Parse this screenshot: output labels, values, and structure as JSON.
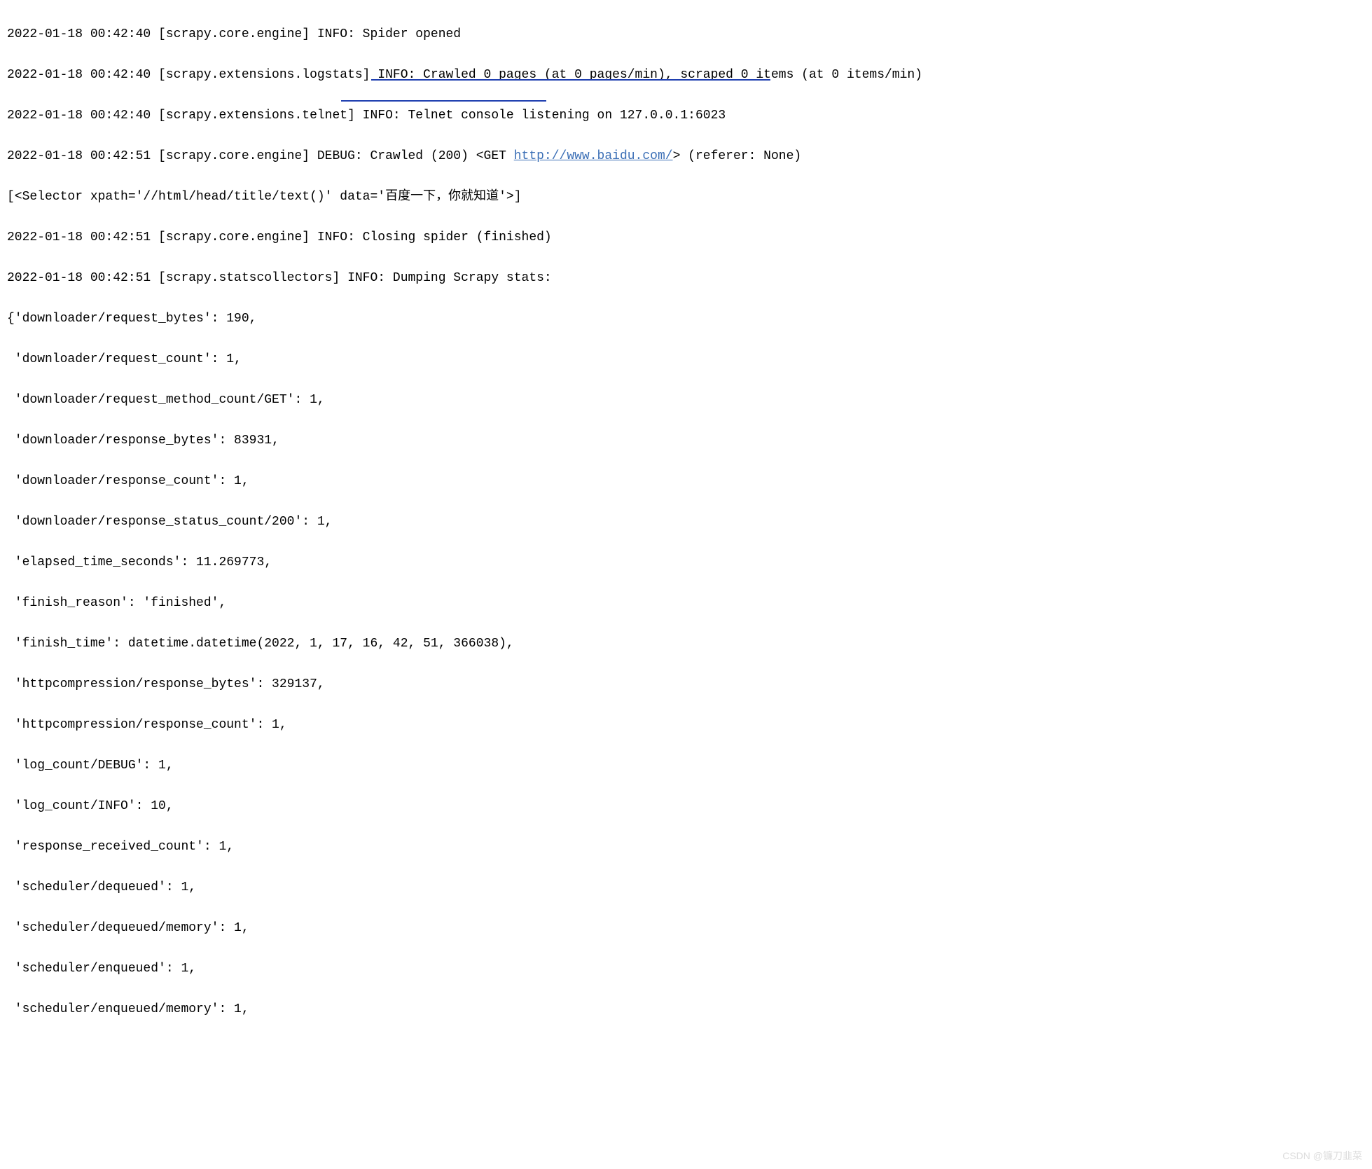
{
  "log": {
    "l1_pre": "2022-01-18 00:42:40 [scrapy.core.engine] INFO: Spider opened",
    "l2_pre": "2022-01-18 00:42:40 [scrapy.extensions.logstats] INFO: Crawled 0 pages (at 0 pages/min), scraped 0 items (at 0 items/min)",
    "l3_pre": "2022-01-18 00:42:40 [scrapy.extensions.telnet] INFO: Telnet console listening on 127.0.0.1:6023",
    "l4_pre": "2022-01-18 00:42:51 [scrapy.core.engine] DEBUG: Crawled (200) <GET ",
    "l4_url": "http://www.baidu.com/",
    "l4_post": "> (referer: None)",
    "l5_pre": "[<Selector xpath='//html/head/title/text()' data='百度一下，你就知道'>]",
    "l6_pre": "2022-01-18 00:42:51 [scrapy.core.engine] INFO: Closing spider (finished)",
    "l7_pre": "2022-01-18 00:42:51 [scrapy.statscollectors] INFO: Dumping Scrapy stats:",
    "l8": "{'downloader/request_bytes': 190,",
    "l9": " 'downloader/request_count': 1,",
    "l10": " 'downloader/request_method_count/GET': 1,",
    "l11": " 'downloader/response_bytes': 83931,",
    "l12": " 'downloader/response_count': 1,",
    "l13": " 'downloader/response_status_count/200': 1,",
    "l14": " 'elapsed_time_seconds': 11.269773,",
    "l15": " 'finish_reason': 'finished',",
    "l16": " 'finish_time': datetime.datetime(2022, 1, 17, 16, 42, 51, 366038),",
    "l17": " 'httpcompression/response_bytes': 329137,",
    "l18": " 'httpcompression/response_count': 1,",
    "l19": " 'log_count/DEBUG': 1,",
    "l20": " 'log_count/INFO': 10,",
    "l21": " 'response_received_count': 1,",
    "l22": " 'scheduler/dequeued': 1,",
    "l23": " 'scheduler/dequeued/memory': 1,",
    "l24": " 'scheduler/enqueued': 1,",
    "l25": " 'scheduler/enqueued/memory': 1,"
  },
  "watermark": "CSDN @镰刀韭菜"
}
